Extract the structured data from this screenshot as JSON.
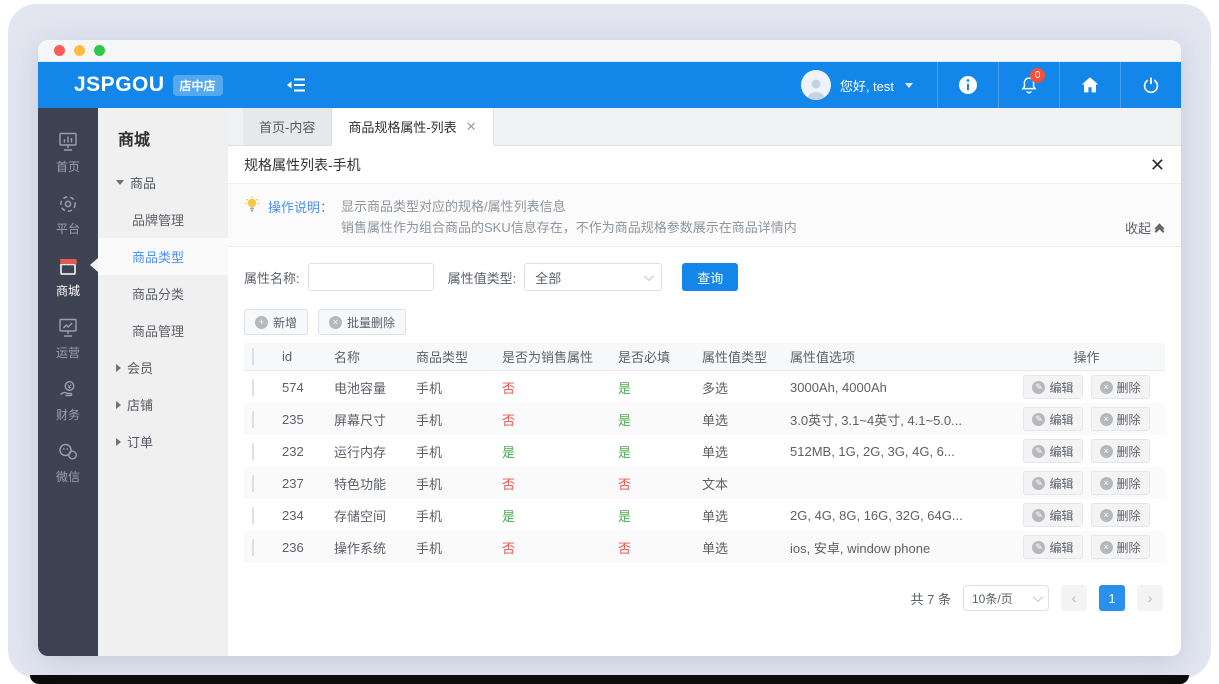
{
  "header": {
    "logo": "JSPGOU",
    "logo_badge": "店中店",
    "greeting": "您好, test",
    "notification_count": "0"
  },
  "sidebar": {
    "items": [
      {
        "label": "首页",
        "icon": "dashboard"
      },
      {
        "label": "平台",
        "icon": "gear"
      },
      {
        "label": "商城",
        "icon": "store",
        "active": true
      },
      {
        "label": "运营",
        "icon": "monitor-chart"
      },
      {
        "label": "财务",
        "icon": "finance"
      },
      {
        "label": "微信",
        "icon": "wechat"
      }
    ]
  },
  "submenu": {
    "title": "商城",
    "product_group": "商品",
    "children": [
      "品牌管理",
      "商品类型",
      "商品分类",
      "商品管理"
    ],
    "selected_child": "商品类型",
    "others": [
      "会员",
      "店铺",
      "订单"
    ]
  },
  "tabs": [
    {
      "label": "首页-内容",
      "active": false
    },
    {
      "label": "商品规格属性-列表",
      "active": true
    }
  ],
  "panel": {
    "title": "规格属性列表-手机",
    "help": {
      "label": "操作说明：",
      "line1": "显示商品类型对应的规格/属性列表信息",
      "line2": "销售属性作为组合商品的SKU信息存在，不作为商品规格参数展示在商品详情内",
      "collapse": "收起"
    },
    "filters": {
      "name_label": "属性名称:",
      "type_label": "属性值类型:",
      "type_value": "全部",
      "search": "查询"
    },
    "toolbar": {
      "add": "新增",
      "batch_delete": "批量删除"
    }
  },
  "table": {
    "columns": [
      "id",
      "名称",
      "商品类型",
      "是否为销售属性",
      "是否必填",
      "属性值类型",
      "属性值选项",
      "操作"
    ],
    "edit": "编辑",
    "delete": "删除",
    "rows": [
      {
        "id": "574",
        "name": "电池容量",
        "category": "手机",
        "sale": "否",
        "required": "是",
        "vtype": "多选",
        "options": "3000Ah, 4000Ah"
      },
      {
        "id": "235",
        "name": "屏幕尺寸",
        "category": "手机",
        "sale": "否",
        "required": "是",
        "vtype": "单选",
        "options": "3.0英寸, 3.1~4英寸, 4.1~5.0..."
      },
      {
        "id": "232",
        "name": "运行内存",
        "category": "手机",
        "sale": "是",
        "required": "是",
        "vtype": "单选",
        "options": "512MB, 1G, 2G, 3G, 4G, 6..."
      },
      {
        "id": "237",
        "name": "特色功能",
        "category": "手机",
        "sale": "否",
        "required": "否",
        "vtype": "文本",
        "options": ""
      },
      {
        "id": "234",
        "name": "存储空间",
        "category": "手机",
        "sale": "是",
        "required": "是",
        "vtype": "单选",
        "options": "2G, 4G, 8G, 16G, 32G, 64G..."
      },
      {
        "id": "236",
        "name": "操作系统",
        "category": "手机",
        "sale": "否",
        "required": "否",
        "vtype": "单选",
        "options": "ios, 安卓, window phone"
      }
    ]
  },
  "pagination": {
    "total": "共 7 条",
    "page_size": "10条/页",
    "current_page": "1"
  },
  "colors": {
    "accent": "#1387e9",
    "danger": "#f0544f",
    "success": "#4cae4c",
    "sidebar": "#3d4352",
    "awning": "#e8574d"
  }
}
